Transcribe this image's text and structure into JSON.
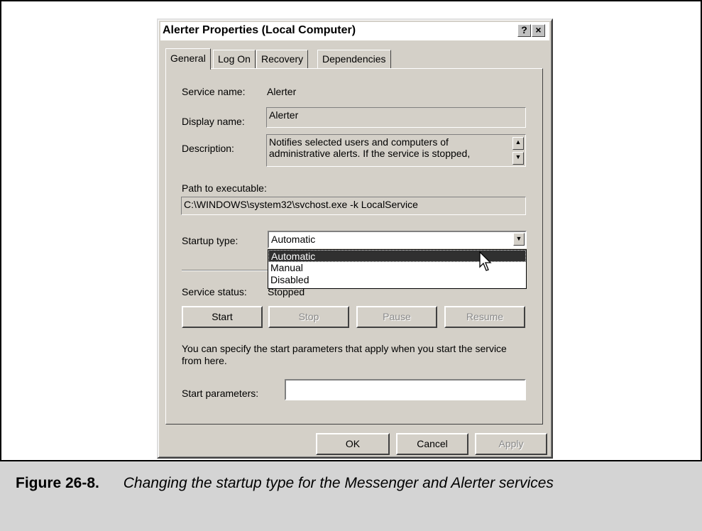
{
  "dialog": {
    "title": "Alerter Properties (Local Computer)",
    "help_btn": "?",
    "close_btn": "×",
    "tabs": [
      {
        "label": "General",
        "active": true
      },
      {
        "label": "Log On",
        "active": false
      },
      {
        "label": "Recovery",
        "active": false
      },
      {
        "label": "Dependencies",
        "active": false
      }
    ],
    "general": {
      "service_name_label": "Service name:",
      "service_name_value": "Alerter",
      "display_name_label": "Display name:",
      "display_name_value": "Alerter",
      "description_label": "Description:",
      "description_line1": "Notifies selected users and computers of",
      "description_line2": "administrative alerts. If the service is stopped,",
      "path_label": "Path to executable:",
      "path_value": "C:\\WINDOWS\\system32\\svchost.exe -k LocalService",
      "startup_type_label": "Startup type:",
      "startup_type_value": "Automatic",
      "startup_options": [
        "Automatic",
        "Manual",
        "Disabled"
      ],
      "service_status_label": "Service status:",
      "service_status_value": "Stopped",
      "start_btn": "Start",
      "stop_btn": "Stop",
      "pause_btn": "Pause",
      "resume_btn": "Resume",
      "hint_line1": "You can specify the start parameters that apply when you start the service",
      "hint_line2": "from here.",
      "start_params_label": "Start parameters:",
      "start_params_value": ""
    },
    "ok_btn": "OK",
    "cancel_btn": "Cancel",
    "apply_btn": "Apply"
  },
  "caption": {
    "figure_number": "Figure 26-8.",
    "figure_text": "Changing the startup type for the Messenger and Alerter services"
  }
}
